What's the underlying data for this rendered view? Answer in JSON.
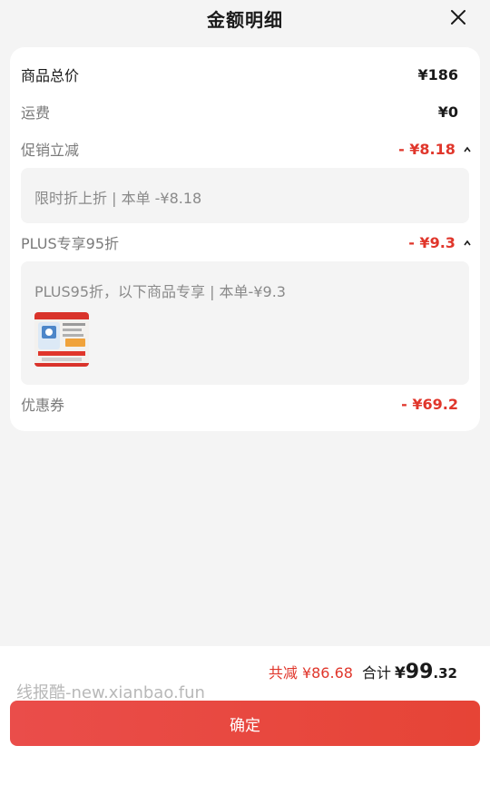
{
  "header": {
    "title": "金额明细"
  },
  "details": {
    "total_price": {
      "label": "商品总价",
      "value": "¥186"
    },
    "shipping": {
      "label": "运费",
      "value": "¥0"
    },
    "promotion": {
      "label": "促销立减",
      "value": "- ¥8.18",
      "detail": "限时折上折 | 本单 -¥8.18"
    },
    "plus": {
      "label": "PLUS专享95折",
      "value": "- ¥9.3",
      "detail": "PLUS95折，以下商品专享 | 本单-¥9.3"
    },
    "coupon": {
      "label": "优惠券",
      "value": "- ¥69.2"
    }
  },
  "footer": {
    "total_reduce": "共减 ¥86.68",
    "total_label": "合计",
    "total_symbol": "¥",
    "total_int": "99",
    "total_dec": ".32",
    "watermark": "线报酷-new.xianbao.fun",
    "confirm_label": "确定"
  },
  "colors": {
    "accent_red": "#e0362b",
    "button_red": "#e64436"
  },
  "icons": {
    "close": "close-icon",
    "caret": "chevron-up-icon"
  }
}
